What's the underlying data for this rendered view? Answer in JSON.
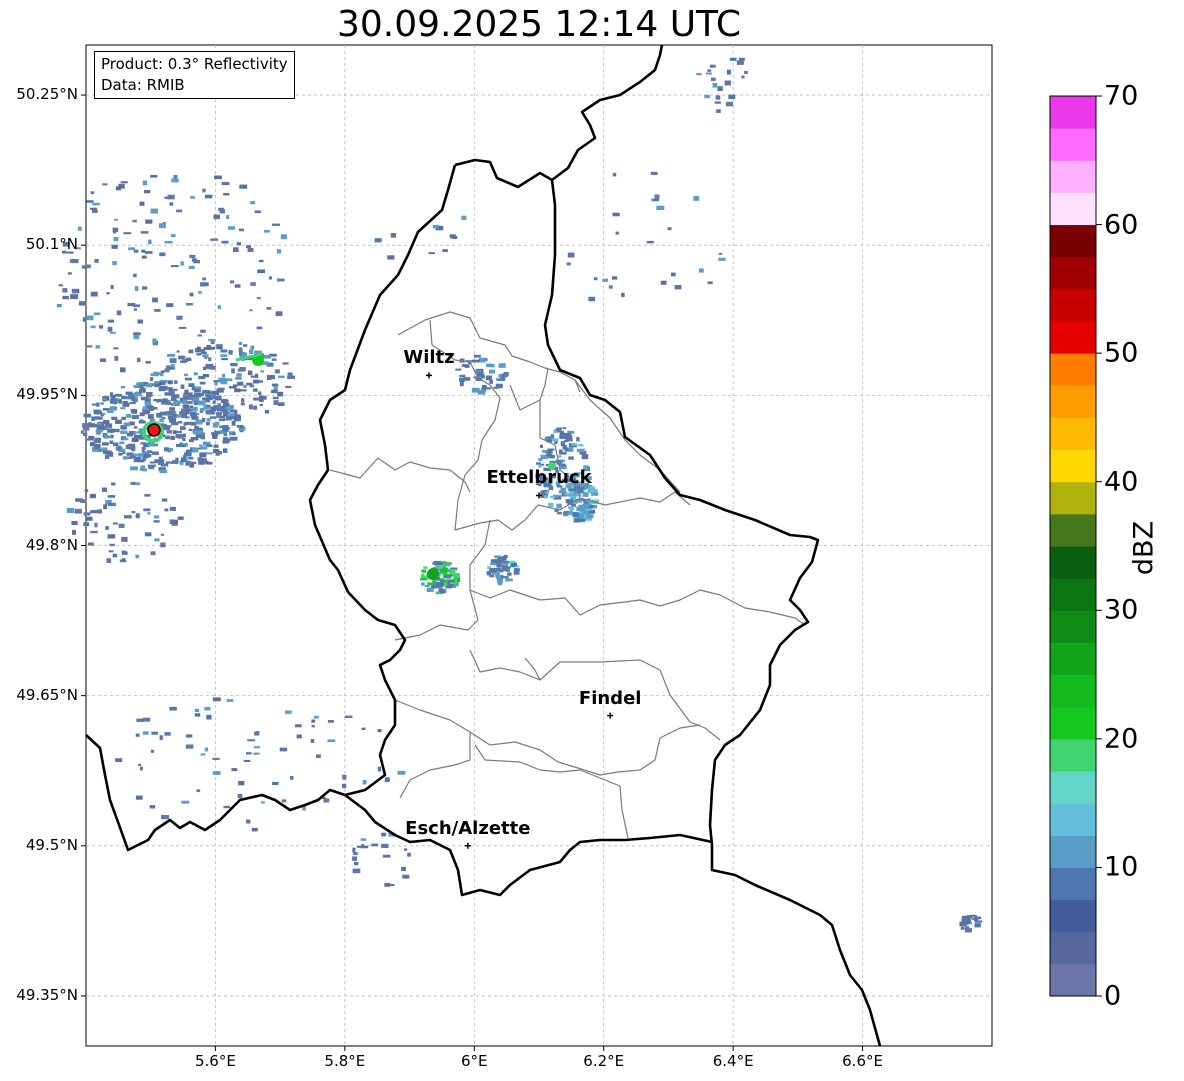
{
  "title": "30.09.2025 12:14 UTC",
  "info": {
    "product": "Product: 0.3° Reflectivity",
    "data": "Data: RMIB"
  },
  "map": {
    "lon_range": [
      5.4,
      6.8
    ],
    "lat_range": [
      49.3,
      50.3
    ],
    "lat_ticks": [
      {
        "v": 50.25,
        "label": "50.25°N"
      },
      {
        "v": 50.1,
        "label": "50.1°N"
      },
      {
        "v": 49.95,
        "label": "49.95°N"
      },
      {
        "v": 49.8,
        "label": "49.8°N"
      },
      {
        "v": 49.65,
        "label": "49.65°N"
      },
      {
        "v": 49.5,
        "label": "49.5°N"
      },
      {
        "v": 49.35,
        "label": "49.35°N"
      }
    ],
    "lon_ticks": [
      {
        "v": 5.6,
        "label": "5.6°E"
      },
      {
        "v": 5.8,
        "label": "5.8°E"
      },
      {
        "v": 6.0,
        "label": "6°E"
      },
      {
        "v": 6.2,
        "label": "6.2°E"
      },
      {
        "v": 6.4,
        "label": "6.4°E"
      },
      {
        "v": 6.6,
        "label": "6.6°E"
      }
    ],
    "cities": [
      {
        "name": "Wiltz",
        "lon": 5.93,
        "lat": 49.97
      },
      {
        "name": "Ettelbruck",
        "lon": 6.1,
        "lat": 49.85
      },
      {
        "name": "Findel",
        "lon": 6.21,
        "lat": 49.63
      },
      {
        "name": "Esch/Alzette",
        "lon": 5.99,
        "lat": 49.5
      }
    ],
    "radar_site": {
      "lon": 5.505,
      "lat": 49.914
    }
  },
  "colorbar": {
    "label": "dBZ",
    "min": 0,
    "max": 70,
    "step": 2.5,
    "ticks": [
      {
        "v": 0,
        "label": "0"
      },
      {
        "v": 10,
        "label": "10"
      },
      {
        "v": 20,
        "label": "20"
      },
      {
        "v": 30,
        "label": "30"
      },
      {
        "v": 40,
        "label": "40"
      },
      {
        "v": 50,
        "label": "50"
      },
      {
        "v": 60,
        "label": "60"
      },
      {
        "v": 70,
        "label": "70"
      }
    ],
    "colors": [
      "#6a77a8",
      "#56689e",
      "#435c9c",
      "#4c78ad",
      "#5a9ec8",
      "#64bfdb",
      "#62d6c6",
      "#3fd46e",
      "#14c81e",
      "#12ba1d",
      "#12a51a",
      "#108c16",
      "#0c7712",
      "#0a5e0e",
      "#46771a",
      "#aeb20a",
      "#ffd800",
      "#ffba00",
      "#ff9c00",
      "#ff7e00",
      "#e60000",
      "#c80000",
      "#a00000",
      "#780000",
      "#ffe0ff",
      "#ffb0ff",
      "#ff6cff",
      "#ea38ea"
    ]
  }
}
